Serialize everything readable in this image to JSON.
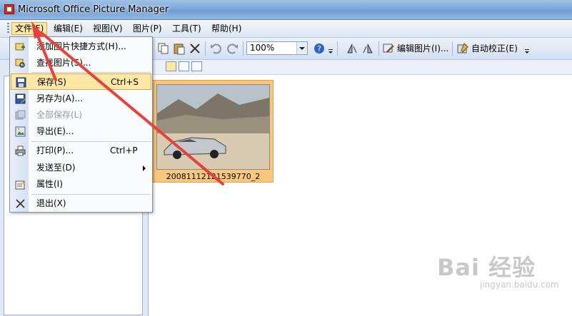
{
  "window": {
    "title": "Microsoft Office Picture Manager"
  },
  "menubar": {
    "items": [
      {
        "label": "文件(F)",
        "active": true
      },
      {
        "label": "编辑(E)"
      },
      {
        "label": "视图(V)"
      },
      {
        "label": "图片(P)"
      },
      {
        "label": "工具(T)"
      },
      {
        "label": "帮助(H)"
      }
    ]
  },
  "toolbar": {
    "zoom_value": "100%",
    "edit_picture_label": "编辑图片(I)...",
    "auto_correct_label": "自动校正(E)"
  },
  "file_menu": {
    "items": [
      {
        "label": "添加图片快捷方式(H)...",
        "icon": "add-shortcut-icon"
      },
      {
        "label": "查找图片(S)...",
        "icon": "find-icon"
      },
      {
        "label": "保存(S)",
        "shortcut": "Ctrl+S",
        "icon": "save-icon",
        "highlighted": true
      },
      {
        "label": "另存为(A)...",
        "icon": "save-as-icon"
      },
      {
        "label": "全部保存(L)",
        "icon": "save-all-icon",
        "disabled": true
      },
      {
        "label": "导出(E)...",
        "icon": "export-icon"
      },
      {
        "label": "打印(P)...",
        "shortcut": "Ctrl+P",
        "icon": "print-icon"
      },
      {
        "label": "发送至(D)",
        "icon": "send-to-icon",
        "submenu": true
      },
      {
        "label": "属性(I)",
        "icon": "properties-icon"
      },
      {
        "label": "退出(X)",
        "icon": "exit-icon"
      }
    ]
  },
  "thumbnail": {
    "caption": "20081112121539770_2"
  },
  "watermark": {
    "brand": "Bai 经验",
    "url": "jingyan.baidu.com"
  },
  "colors": {
    "highlight": "#ffe8a6",
    "arrow": "#e8413a",
    "thumb_selected": "#f7c77c"
  }
}
